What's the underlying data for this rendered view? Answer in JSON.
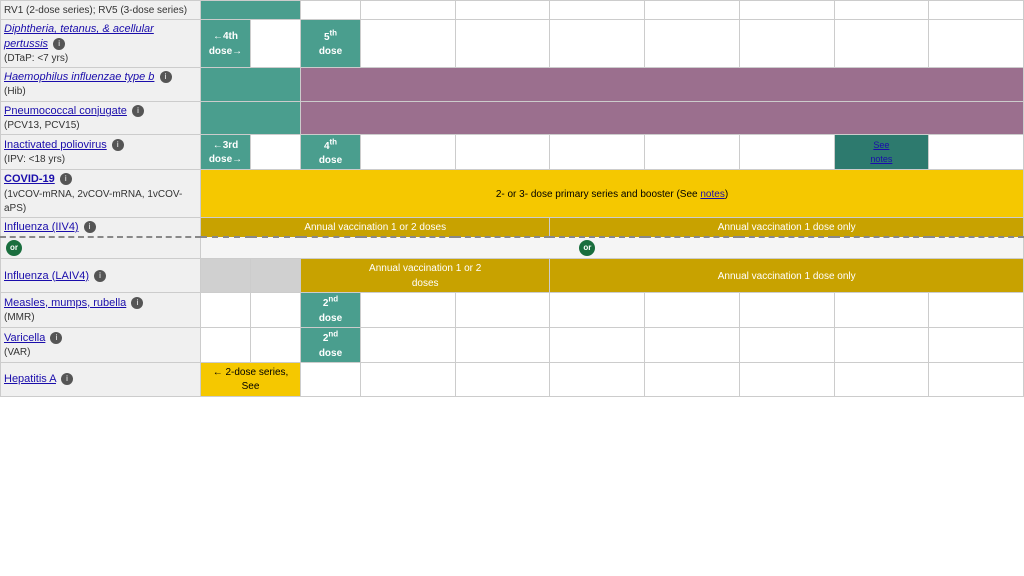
{
  "vaccines": [
    {
      "id": "rv",
      "name": null,
      "subtitle": "RV1 (2-dose series); RV5 (3-dose series)",
      "link": null,
      "row_type": "partial_top"
    },
    {
      "id": "dtap",
      "name": "Diphtheria, tetanus, & acellular pertussis",
      "subtitle": "(DTaP: <7 yrs)",
      "link": true,
      "info": true,
      "doses": {
        "dose4_label": "←4th dose→",
        "dose5_label": "5th dose"
      }
    },
    {
      "id": "hib",
      "name": "Haemophilus influenzae type b",
      "subtitle": "(Hib)",
      "link": true,
      "info": true
    },
    {
      "id": "pcv",
      "name": "Pneumococcal conjugate",
      "subtitle": "(PCV13, PCV15)",
      "link": true,
      "info": true
    },
    {
      "id": "ipv",
      "name": "Inactivated poliovirus",
      "subtitle": "(IPV: <18 yrs)",
      "link": true,
      "info": true,
      "doses": {
        "dose3_label": "←3rd dose→",
        "dose4_label": "4th dose",
        "see_notes": "See notes"
      }
    },
    {
      "id": "covid",
      "name": "COVID-19",
      "subtitle": "(1vCOV-mRNA, 2vCOV-mRNA, 1vCOV-aPS)",
      "link": true,
      "info": true,
      "label": "2- or 3- dose primary series and booster (See notes)"
    },
    {
      "id": "influenza_iiv4",
      "name": "Influenza (IIV4)",
      "info": true,
      "annual_1_label": "Annual vaccination 1 or 2 doses",
      "annual_2_label": "Annual vaccination 1 dose only"
    },
    {
      "id": "influenza_laiv4",
      "name": "Influenza (LAIV4)",
      "info": true,
      "annual_1_label": "Annual vaccination 1 or 2 doses",
      "annual_2_label": "Annual vaccination 1 dose only",
      "is_or": true
    },
    {
      "id": "mmr",
      "name": "Measles, mumps, rubella",
      "subtitle": "(MMR)",
      "link": true,
      "info": true,
      "dose_label": "2nd dose"
    },
    {
      "id": "varicella",
      "name": "Varicella",
      "subtitle": "(VAR)",
      "link": true,
      "info": true,
      "dose_label": "2nd dose"
    },
    {
      "id": "hepa",
      "name": "Hepatitis A",
      "link": true,
      "info": true,
      "dose_label": "← 2-dose series, See"
    }
  ],
  "info_icon_label": "i",
  "or_label": "or",
  "notes_link": "notes"
}
